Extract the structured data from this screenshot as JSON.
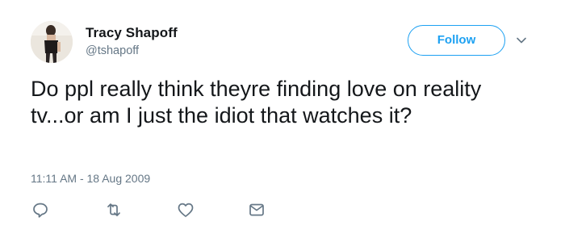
{
  "author": {
    "display_name": "Tracy Shapoff",
    "handle": "@tshapoff",
    "avatar_icon": "profile-photo"
  },
  "follow_button": {
    "label": "Follow"
  },
  "tweet": {
    "text": "Do ppl really think theyre finding love on reality tv...or am I just the idiot that watches it?",
    "timestamp": "11:11 AM - 18 Aug 2009"
  },
  "actions": [
    {
      "icon": "reply-icon"
    },
    {
      "icon": "retweet-icon"
    },
    {
      "icon": "like-icon"
    },
    {
      "icon": "direct-message-icon"
    }
  ],
  "colors": {
    "accent": "#1da1f2",
    "text": "#14171a",
    "secondary": "#657786"
  }
}
